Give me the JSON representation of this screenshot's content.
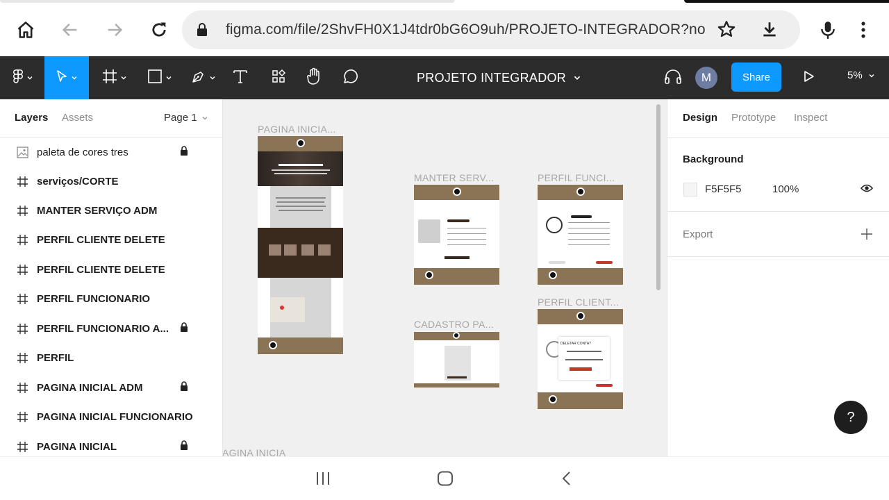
{
  "browser": {
    "url": "figma.com/file/2ShvFH0X1J4tdr0bG6O9uh/PROJETO-INTEGRADOR?nod",
    "icons": [
      "home-icon",
      "back-icon",
      "forward-icon",
      "reload-icon",
      "lock-icon",
      "star-icon",
      "download-icon",
      "mic-icon",
      "menu-dots-icon"
    ]
  },
  "toolbar": {
    "project_title": "PROJETO INTEGRADOR",
    "avatar_initial": "M",
    "share_label": "Share",
    "zoom": "5%",
    "tools": [
      "figma-menu-icon",
      "move-tool-icon",
      "frame-tool-icon",
      "shape-tool-icon",
      "pen-tool-icon",
      "text-tool-icon",
      "resources-icon",
      "hand-tool-icon",
      "comment-icon",
      "headphones-icon",
      "play-icon"
    ]
  },
  "left_panel": {
    "tabs": {
      "layers": "Layers",
      "assets": "Assets"
    },
    "page": "Page 1",
    "layers": [
      {
        "name": "paleta de cores tres",
        "type": "image",
        "locked": true
      },
      {
        "name": "serviços/CORTE",
        "type": "frame",
        "locked": false
      },
      {
        "name": "MANTER SERVIÇO ADM",
        "type": "frame",
        "locked": false
      },
      {
        "name": "PERFIL CLIENTE DELETE",
        "type": "frame",
        "locked": false
      },
      {
        "name": "PERFIL CLIENTE DELETE",
        "type": "frame",
        "locked": false
      },
      {
        "name": "PERFIL FUNCIONARIO",
        "type": "frame",
        "locked": false
      },
      {
        "name": "PERFIL FUNCIONARIO A...",
        "type": "frame",
        "locked": true
      },
      {
        "name": "PERFIL",
        "type": "frame",
        "locked": false
      },
      {
        "name": "PAGINA INICIAL ADM",
        "type": "frame",
        "locked": true
      },
      {
        "name": "PAGINA INICIAL FUNCIONARIO",
        "type": "frame",
        "locked": false
      },
      {
        "name": "PAGINA INICIAL",
        "type": "frame",
        "locked": true
      }
    ]
  },
  "canvas": {
    "frame_labels": {
      "pagina_inicial": "PAGINA INICIA...",
      "manter_servico": "MANTER SERV...",
      "perfil_funcionario": "PERFIL FUNCI...",
      "perfil_cliente": "PERFIL CLIENT...",
      "cadastro": "CADASTRO PA...",
      "bottom_cut": "AGINA INICIA"
    },
    "delete_dialog_title": "DELETAR CONTA?"
  },
  "right_panel": {
    "tabs": {
      "design": "Design",
      "prototype": "Prototype",
      "inspect": "Inspect"
    },
    "background_heading": "Background",
    "background_hex": "F5F5F5",
    "background_opacity": "100%",
    "export_heading": "Export",
    "help": "?"
  },
  "colors": {
    "accent": "#0d99ff",
    "toolbar": "#2c2c2c",
    "frame_brown": "#8b7355"
  }
}
